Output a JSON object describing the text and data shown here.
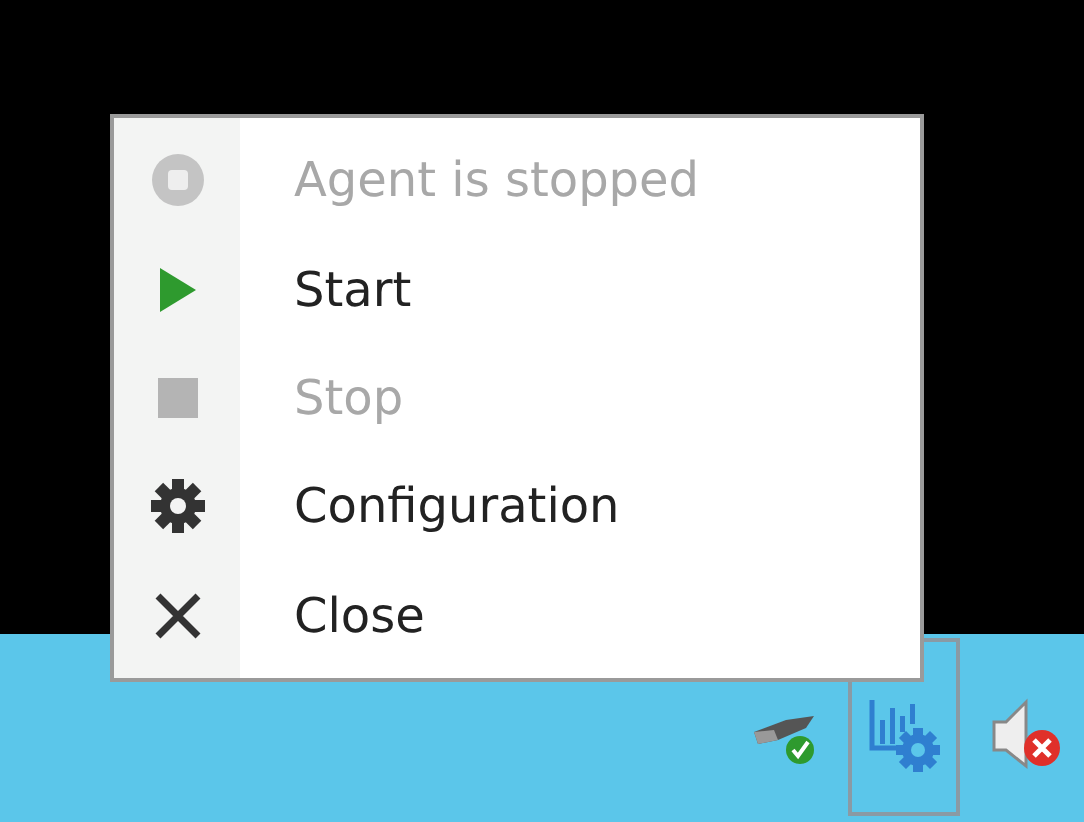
{
  "context_menu": {
    "items": [
      {
        "kind": "status",
        "label": "Agent is stopped",
        "disabled": true
      },
      {
        "kind": "start",
        "label": "Start",
        "disabled": false
      },
      {
        "kind": "stop",
        "label": "Stop",
        "disabled": true
      },
      {
        "kind": "settings",
        "label": "Configuration",
        "disabled": false
      },
      {
        "kind": "close",
        "label": "Close",
        "disabled": false
      }
    ]
  },
  "tray": {
    "icons": [
      {
        "kind": "usb",
        "selected": false
      },
      {
        "kind": "agent",
        "selected": true
      },
      {
        "kind": "volume",
        "selected": false
      }
    ]
  }
}
